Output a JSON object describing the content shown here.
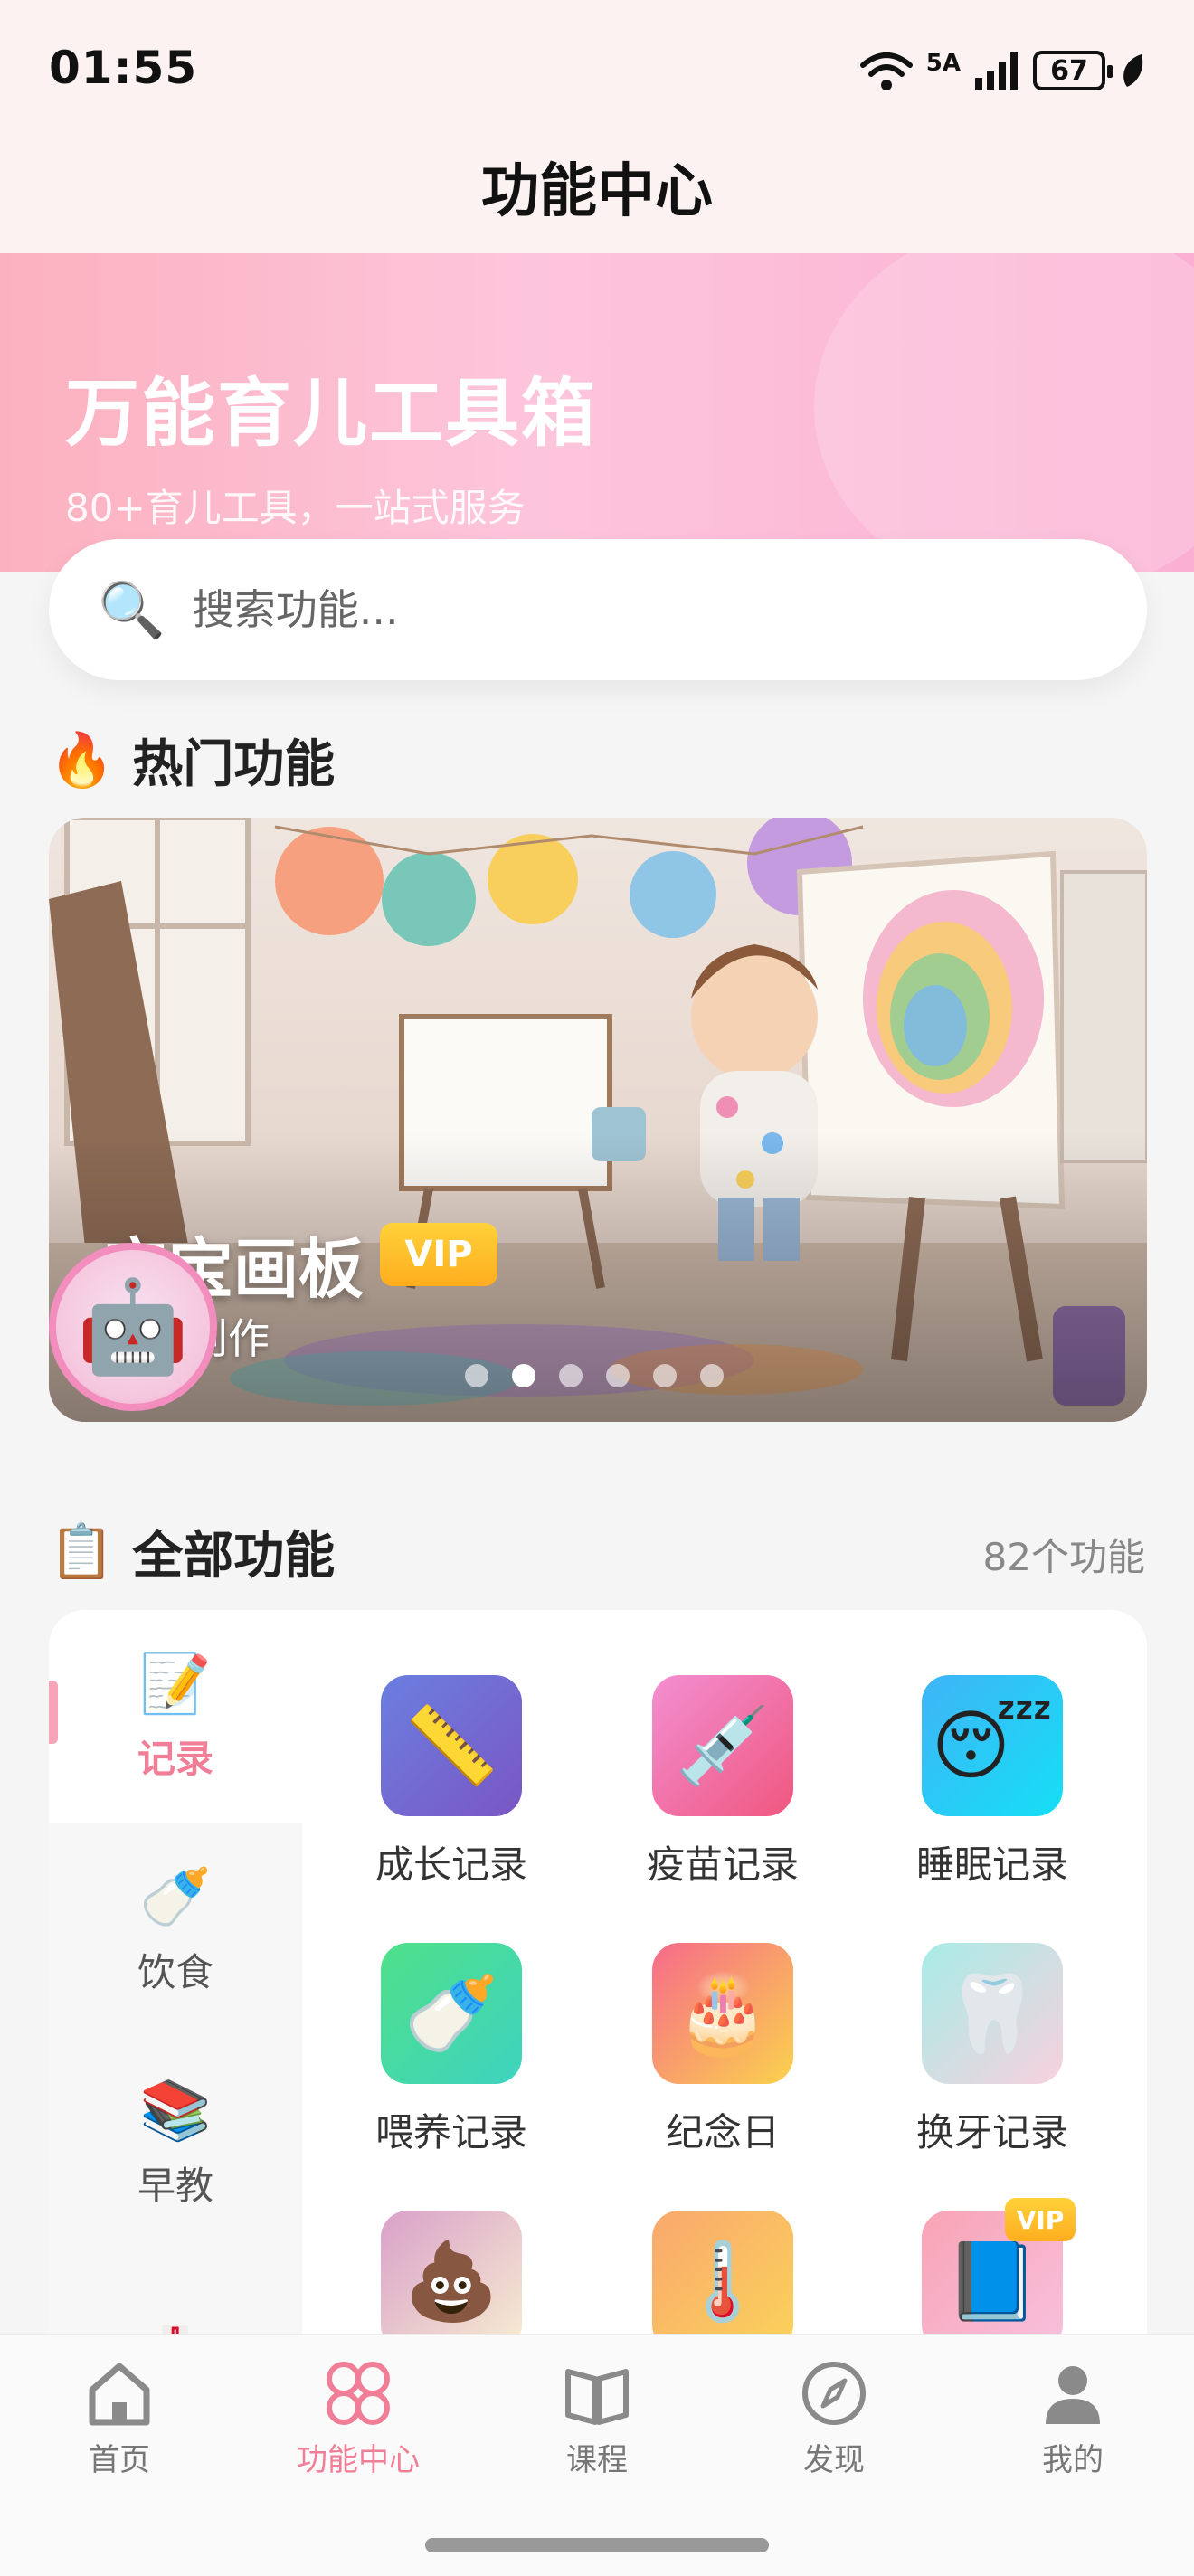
{
  "status_bar": {
    "time": "01:55",
    "network": "5A",
    "battery": "67"
  },
  "header": {
    "title": "功能中心"
  },
  "hero": {
    "title": "万能育儿工具箱",
    "subtitle": "80+育儿工具，一站式服务"
  },
  "search": {
    "placeholder": "搜索功能..."
  },
  "hot": {
    "heading": "热门功能",
    "card": {
      "title": "宝宝画板",
      "badge": "VIP",
      "subtitle": "绘画创作",
      "dots_total": 6,
      "active_dot": 2
    }
  },
  "all": {
    "heading": "全部功能",
    "count": "82个功能",
    "categories": [
      {
        "label": "记录",
        "icon": "memo-icon",
        "active": true
      },
      {
        "label": "饮食",
        "icon": "baby-bottle-icon",
        "active": false
      },
      {
        "label": "早教",
        "icon": "books-icon",
        "active": false
      }
    ],
    "tools": [
      {
        "name": "成长记录",
        "icon": "ruler-icon"
      },
      {
        "name": "疫苗记录",
        "icon": "syringe-icon"
      },
      {
        "name": "睡眠记录",
        "icon": "sleeping-face-icon"
      },
      {
        "name": "喂养记录",
        "icon": "baby-bottle-icon"
      },
      {
        "name": "纪念日",
        "icon": "cake-icon"
      },
      {
        "name": "换牙记录",
        "icon": "tooth-icon"
      },
      {
        "name": "",
        "icon": "poop-icon"
      },
      {
        "name": "",
        "icon": "thermometer-icon"
      },
      {
        "name": "",
        "icon": "notebook-icon",
        "badge": "VIP"
      }
    ]
  },
  "nav": {
    "items": [
      {
        "label": "首页",
        "icon": "home-icon"
      },
      {
        "label": "功能中心",
        "icon": "function-grid-icon",
        "active": true
      },
      {
        "label": "课程",
        "icon": "book-open-icon"
      },
      {
        "label": "发现",
        "icon": "compass-icon"
      },
      {
        "label": "我的",
        "icon": "user-icon"
      }
    ]
  },
  "colors": {
    "accent_pink": "#f07e96",
    "vip_gold": "#ffb21f"
  }
}
